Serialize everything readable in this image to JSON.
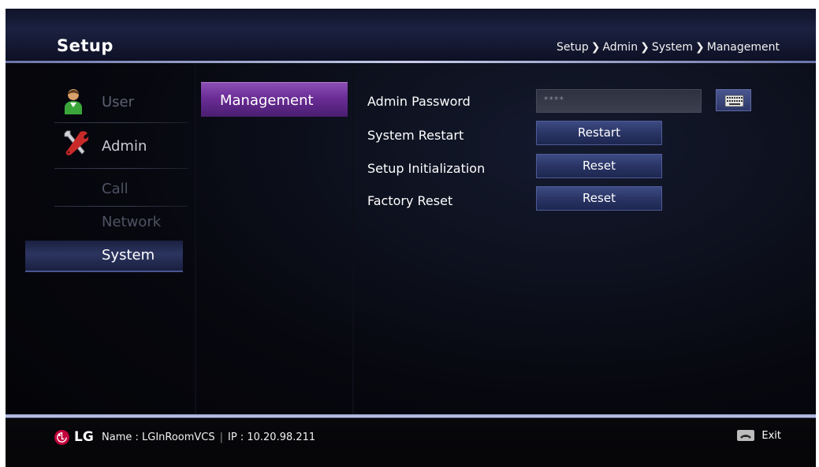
{
  "header": {
    "title": "Setup",
    "breadcrumb": [
      "Setup",
      "Admin",
      "System",
      "Management"
    ],
    "breadcrumb_separator": "❯"
  },
  "sidebar": {
    "items": [
      {
        "label": "User",
        "icon": "user-icon",
        "state": "dimmed"
      },
      {
        "label": "Admin",
        "icon": "tools-icon",
        "state": "active-category"
      },
      {
        "label": "Call",
        "state": "dimmed"
      },
      {
        "label": "Network",
        "state": "dimmed"
      },
      {
        "label": "System",
        "state": "selected"
      }
    ]
  },
  "submenu": {
    "items": [
      {
        "label": "Management",
        "state": "selected"
      }
    ]
  },
  "settings": {
    "admin_password": {
      "label": "Admin Password",
      "value": "****",
      "keyboard_icon": "keyboard-icon"
    },
    "system_restart": {
      "label": "System Restart",
      "button": "Restart"
    },
    "setup_initialization": {
      "label": "Setup Initialization",
      "button": "Reset"
    },
    "factory_reset": {
      "label": "Factory Reset",
      "button": "Reset"
    }
  },
  "footer": {
    "brand": "LG",
    "name_label": "Name : LGInRoomVCS",
    "ip_label": "IP : 10.20.98.211",
    "separator": "|",
    "exit_label": "Exit",
    "exit_icon": "phone-hangup-icon"
  },
  "colors": {
    "accent_purple": "#6a2c96",
    "button_blue": "#2a3565",
    "lg_red": "#c4003c",
    "background": "#07080f"
  }
}
